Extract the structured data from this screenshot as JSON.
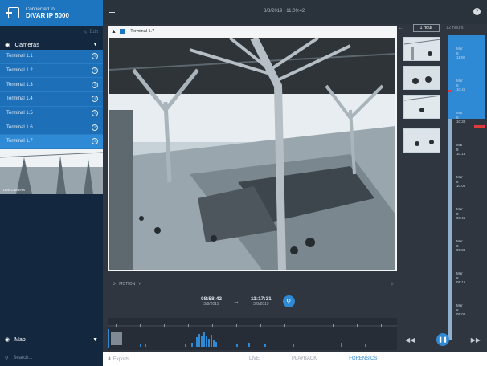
{
  "connection": {
    "label": "Connected to",
    "name": "DIVAR IP 5000"
  },
  "sidebar": {
    "edit_label": "Edit",
    "cameras_title": "Cameras",
    "cameras": [
      "Terminal 1.1",
      "Terminal 1.2",
      "Terminal 1.3",
      "Terminal 1.4",
      "Terminal 1.5",
      "Terminal 1.6",
      "Terminal 1.7"
    ],
    "thumb_caption": "LIVE CAMERA",
    "map_label": "Map",
    "search_placeholder": "Search..."
  },
  "topbar": {
    "datetime": "3/8/2019  |  11:00:42"
  },
  "viewer": {
    "camera_label": "- Terminal 1.7"
  },
  "controls": {
    "motion_label": "MOTION",
    "start_time": "08:58:42",
    "start_date": "3/8/2019",
    "end_time": "11:17:31",
    "end_date": "3/8/2019"
  },
  "rightpanel": {
    "range_1h": "1 hour",
    "range_12h": "12 hours",
    "labels": [
      "Mar 8 11:00",
      "Mar 8 10:45",
      "Mar 8 10:30",
      "Mar 8 10:15",
      "Mar 8 10:00",
      "Mar 8 09:45",
      "Mar 8 09:30",
      "Mar 8 09:15",
      "Mar 8 09:00"
    ]
  },
  "bottombar": {
    "exports": "Exports",
    "tabs": [
      "LIVE",
      "PLAYBACK",
      "FORENSICS"
    ],
    "active_tab": "FORENSICS"
  },
  "colors": {
    "accent": "#2f8ad6",
    "sidebar": "#13273f",
    "marker": "#e03a3a"
  }
}
